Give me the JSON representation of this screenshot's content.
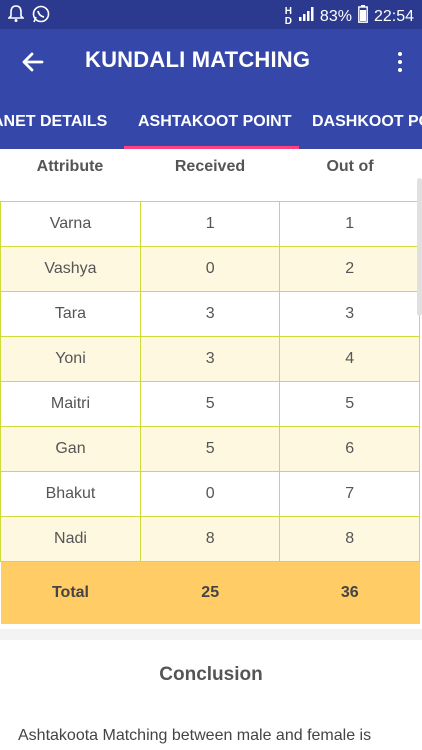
{
  "statusbar": {
    "battery": "83%",
    "time": "22:54"
  },
  "appbar": {
    "title": "KUNDALI MATCHING"
  },
  "tabs": [
    {
      "label": "ANET DETAILS"
    },
    {
      "label": "ASHTAKOOT POINT"
    },
    {
      "label": "DASHKOOT PO"
    }
  ],
  "table": {
    "headers": {
      "attribute": "Attribute",
      "received": "Received",
      "outof": "Out of"
    },
    "rows": [
      {
        "attribute": "Varna",
        "received": "1",
        "outof": "1"
      },
      {
        "attribute": "Vashya",
        "received": "0",
        "outof": "2"
      },
      {
        "attribute": "Tara",
        "received": "3",
        "outof": "3"
      },
      {
        "attribute": "Yoni",
        "received": "3",
        "outof": "4"
      },
      {
        "attribute": "Maitri",
        "received": "5",
        "outof": "5"
      },
      {
        "attribute": "Gan",
        "received": "5",
        "outof": "6"
      },
      {
        "attribute": "Bhakut",
        "received": "0",
        "outof": "7"
      },
      {
        "attribute": "Nadi",
        "received": "8",
        "outof": "8"
      }
    ],
    "total": {
      "label": "Total",
      "received": "25",
      "outof": "36"
    }
  },
  "conclusion": {
    "title": "Conclusion",
    "text": "Ashtakoota Matching between male and female is"
  }
}
